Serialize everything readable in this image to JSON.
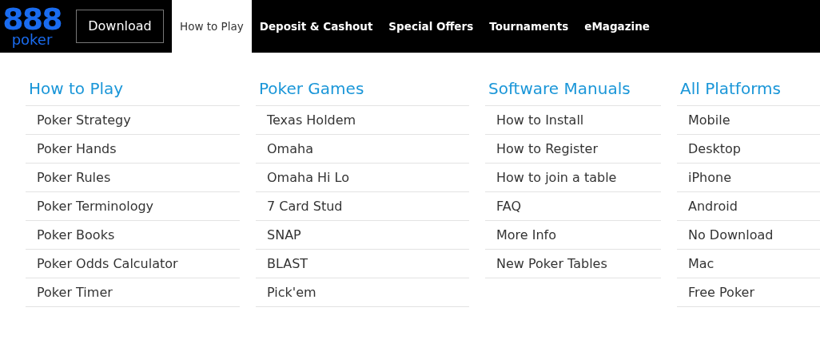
{
  "logo": {
    "mark": "888",
    "word": "poker"
  },
  "download_button": "Download",
  "nav": [
    {
      "label": "How to Play",
      "selected": true
    },
    {
      "label": "Deposit & Cashout",
      "selected": false
    },
    {
      "label": "Special Offers",
      "selected": false
    },
    {
      "label": "Tournaments",
      "selected": false
    },
    {
      "label": "eMagazine",
      "selected": false
    }
  ],
  "columns": [
    {
      "heading": "How to Play",
      "items": [
        "Poker Strategy",
        "Poker Hands",
        "Poker Rules",
        "Poker Terminology",
        "Poker Books",
        "Poker Odds Calculator",
        "Poker Timer"
      ]
    },
    {
      "heading": "Poker Games",
      "items": [
        "Texas Holdem",
        "Omaha",
        "Omaha Hi Lo",
        "7 Card Stud",
        "SNAP",
        "BLAST",
        "Pick'em"
      ]
    },
    {
      "heading": "Software Manuals",
      "items": [
        "How to Install",
        "How to Register",
        "How to join a table",
        "FAQ",
        "More Info",
        "New Poker Tables"
      ]
    },
    {
      "heading": "All Platforms",
      "items": [
        "Mobile",
        "Desktop",
        "iPhone",
        "Android",
        "No Download",
        "Mac",
        "Free Poker"
      ]
    }
  ]
}
